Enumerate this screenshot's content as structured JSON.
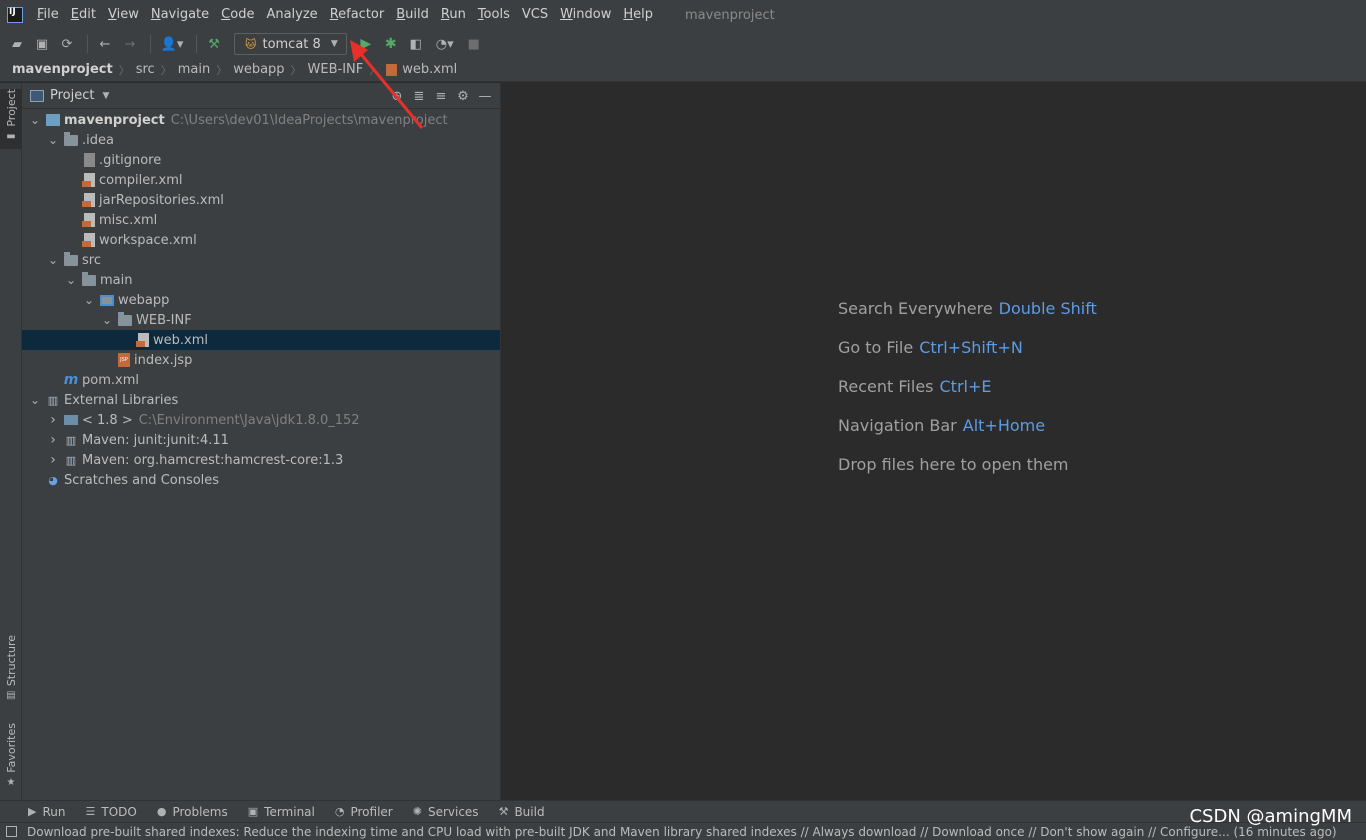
{
  "menubar": {
    "items": [
      {
        "label": "File",
        "u": "F",
        "rest": "ile"
      },
      {
        "label": "Edit",
        "u": "E",
        "rest": "dit"
      },
      {
        "label": "View",
        "u": "V",
        "rest": "iew"
      },
      {
        "label": "Navigate",
        "u": "N",
        "rest": "avigate"
      },
      {
        "label": "Code",
        "u": "C",
        "rest": "ode"
      },
      {
        "label": "Analyze",
        "u": "",
        "rest": "Analyze"
      },
      {
        "label": "Refactor",
        "u": "R",
        "rest": "efactor"
      },
      {
        "label": "Build",
        "u": "B",
        "rest": "uild"
      },
      {
        "label": "Run",
        "u": "R",
        "rest": "un"
      },
      {
        "label": "Tools",
        "u": "T",
        "rest": "ools"
      },
      {
        "label": "VCS",
        "u": "",
        "rest": "VCS"
      },
      {
        "label": "Window",
        "u": "W",
        "rest": "indow"
      },
      {
        "label": "Help",
        "u": "H",
        "rest": "elp"
      }
    ],
    "window_title": "mavenproject"
  },
  "toolbar": {
    "run_config": "tomcat 8"
  },
  "breadcrumb": [
    "mavenproject",
    "src",
    "main",
    "webapp",
    "WEB-INF",
    "web.xml"
  ],
  "left_stripe": {
    "project": "Project",
    "structure": "Structure",
    "favorites": "Favorites"
  },
  "project_panel": {
    "title": "Project",
    "tree": [
      {
        "indent": 0,
        "arrow": "open",
        "icon": "module",
        "label": "mavenproject",
        "bold": true,
        "path": "C:\\Users\\dev01\\IdeaProjects\\mavenproject"
      },
      {
        "indent": 1,
        "arrow": "open",
        "icon": "folder",
        "label": ".idea"
      },
      {
        "indent": 2,
        "arrow": "none",
        "icon": "git",
        "label": ".gitignore"
      },
      {
        "indent": 2,
        "arrow": "none",
        "icon": "xml",
        "label": "compiler.xml"
      },
      {
        "indent": 2,
        "arrow": "none",
        "icon": "xml",
        "label": "jarRepositories.xml"
      },
      {
        "indent": 2,
        "arrow": "none",
        "icon": "xml",
        "label": "misc.xml"
      },
      {
        "indent": 2,
        "arrow": "none",
        "icon": "xml",
        "label": "workspace.xml"
      },
      {
        "indent": 1,
        "arrow": "open",
        "icon": "folder",
        "label": "src"
      },
      {
        "indent": 2,
        "arrow": "open",
        "icon": "folder",
        "label": "main"
      },
      {
        "indent": 3,
        "arrow": "open",
        "icon": "webroot",
        "label": "webapp"
      },
      {
        "indent": 4,
        "arrow": "open",
        "icon": "folder",
        "label": "WEB-INF"
      },
      {
        "indent": 5,
        "arrow": "none",
        "icon": "xml",
        "label": "web.xml",
        "selected": true
      },
      {
        "indent": 4,
        "arrow": "none",
        "icon": "jsp",
        "label": "index.jsp"
      },
      {
        "indent": 1,
        "arrow": "none",
        "icon": "maven",
        "label": "pom.xml"
      },
      {
        "indent": 0,
        "arrow": "open",
        "icon": "lib",
        "label": "External Libraries"
      },
      {
        "indent": 1,
        "arrow": "closed",
        "icon": "jdk",
        "label": "< 1.8 >",
        "path": "C:\\Environment\\Java\\jdk1.8.0_152"
      },
      {
        "indent": 1,
        "arrow": "closed",
        "icon": "lib",
        "label": "Maven: junit:junit:4.11"
      },
      {
        "indent": 1,
        "arrow": "closed",
        "icon": "lib",
        "label": "Maven: org.hamcrest:hamcrest-core:1.3"
      },
      {
        "indent": 0,
        "arrow": "none",
        "icon": "scratch",
        "label": "Scratches and Consoles"
      }
    ]
  },
  "editor": {
    "hints": [
      {
        "text": "Search Everywhere",
        "key": "Double Shift"
      },
      {
        "text": "Go to File",
        "key": "Ctrl+Shift+N"
      },
      {
        "text": "Recent Files",
        "key": "Ctrl+E"
      },
      {
        "text": "Navigation Bar",
        "key": "Alt+Home"
      },
      {
        "text": "Drop files here to open them",
        "key": ""
      }
    ]
  },
  "bottom_tools": [
    {
      "name": "run",
      "icon": "▶",
      "label": "Run"
    },
    {
      "name": "todo",
      "icon": "☰",
      "label": "TODO"
    },
    {
      "name": "problems",
      "icon": "●",
      "label": "Problems"
    },
    {
      "name": "terminal",
      "icon": "▣",
      "label": "Terminal"
    },
    {
      "name": "profiler",
      "icon": "◔",
      "label": "Profiler"
    },
    {
      "name": "services",
      "icon": "✺",
      "label": "Services"
    },
    {
      "name": "build",
      "icon": "⚒",
      "label": "Build"
    }
  ],
  "statusbar": {
    "message": "Download pre-built shared indexes: Reduce the indexing time and CPU load with pre-built JDK and Maven library shared indexes // Always download // Download once // Don't show again // Configure... (16 minutes ago)"
  },
  "watermark": "CSDN @amingMM",
  "colors": {
    "accent_key": "#5c9ce6",
    "selection": "#0d293e",
    "run_green": "#59a869",
    "annotation_red": "#e8302a"
  }
}
